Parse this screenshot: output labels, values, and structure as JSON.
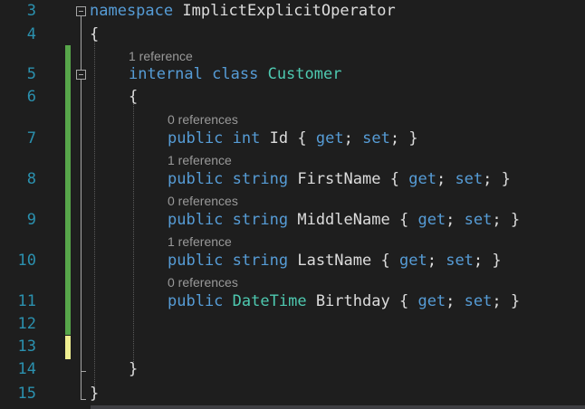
{
  "editor": {
    "line_numbers": [
      "3",
      "4",
      "5",
      "6",
      "7",
      "8",
      "9",
      "10",
      "11",
      "12",
      "13",
      "14",
      "15"
    ],
    "lines": {
      "l3": {
        "kw": "namespace",
        "name": "ImplictExplicitOperator"
      },
      "l4": {
        "text": "{"
      },
      "lens5": "1 reference",
      "l5": {
        "kw1": "internal",
        "kw2": "class",
        "type": "Customer"
      },
      "l6": {
        "text": "{"
      },
      "lens7": "0 references",
      "l7": {
        "kw1": "public",
        "kw2": "int",
        "name": "Id",
        "open": "{",
        "get": "get",
        "semi1": ";",
        "set": "set",
        "semi2": ";",
        "close": "}"
      },
      "lens8": "1 reference",
      "l8": {
        "kw1": "public",
        "kw2": "string",
        "name": "FirstName",
        "open": "{",
        "get": "get",
        "semi1": ";",
        "set": "set",
        "semi2": ";",
        "close": "}"
      },
      "lens9": "0 references",
      "l9": {
        "kw1": "public",
        "kw2": "string",
        "name": "MiddleName",
        "open": "{",
        "get": "get",
        "semi1": ";",
        "set": "set",
        "semi2": ";",
        "close": "}"
      },
      "lens10": "1 reference",
      "l10": {
        "kw1": "public",
        "kw2": "string",
        "name": "LastName",
        "open": "{",
        "get": "get",
        "semi1": ";",
        "set": "set",
        "semi2": ";",
        "close": "}"
      },
      "lens11": "0 references",
      "l11": {
        "kw1": "public",
        "type": "DateTime",
        "name": "Birthday",
        "open": "{",
        "get": "get",
        "semi1": ";",
        "set": "set",
        "semi2": ";",
        "close": "}"
      },
      "l14": {
        "text": "}"
      },
      "l15": {
        "text": "}"
      }
    },
    "colors": {
      "background": "#1e1e1e",
      "line_number": "#2b91af",
      "keyword": "#569cd6",
      "type": "#4ec9b0",
      "plain": "#dcdcdc",
      "codelens": "#999999",
      "saved_change": "#57a64a",
      "unsaved_change": "#efef91"
    }
  }
}
